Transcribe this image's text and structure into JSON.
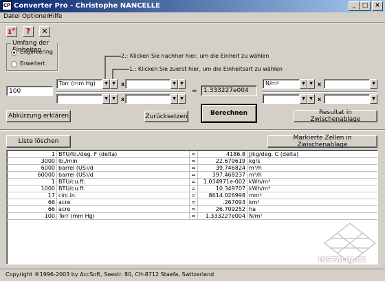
{
  "window": {
    "title": "Converter Pro - Christophe NANCELLE",
    "app_icon": "CP"
  },
  "menu": [
    "Datei",
    "Optionen",
    "Hilfe"
  ],
  "toolbar_icons": [
    "thermometer-icon",
    "pin-icon",
    "close-x-icon"
  ],
  "units_group": {
    "title": "Umfang der Einheiten",
    "options": [
      "Engineering",
      "Erweitert"
    ],
    "selected": "Engineering"
  },
  "hints": {
    "step2": "2.: Klicken Sie nachher hier, um die Einheit zu wählen",
    "step1": "1.: Klicken Sie zuerst hier, um die Einheitsart zu wählen"
  },
  "input_value": "100",
  "left_unit": "Torr (mm Hg)",
  "result_value": "1.333227e004",
  "right_unit": "N/m²",
  "operators": {
    "mult": "x",
    "div": "/",
    "equals": "="
  },
  "buttons": {
    "abbrev": "Abkürzung erklären",
    "reset": "Zurücksetzen",
    "calculate": "Berechnen",
    "result_clip": "Resultat in Zwischenablage",
    "clear_list": "Liste löschen",
    "marked_clip": "Markierte Zellen in Zwischenablage"
  },
  "table": [
    {
      "qty": "1",
      "unit": "BTU/lb./deg. F (delta)",
      "eq": "=",
      "value": "4186.8",
      "result_unit": "J/kg/deg. C (delta)"
    },
    {
      "qty": "3000",
      "unit": "lb./min",
      "eq": "=",
      "value": "22.679619",
      "result_unit": "kg/s"
    },
    {
      "qty": "6000",
      "unit": "barrel (US)/d",
      "eq": "=",
      "value": "39.746824",
      "result_unit": "m³/h"
    },
    {
      "qty": "60000",
      "unit": "barrel (US)/d",
      "eq": "=",
      "value": "397.468237",
      "result_unit": "m³/h"
    },
    {
      "qty": "1",
      "unit": "BTU/cu.ft.",
      "eq": "=",
      "value": "1.034971e-002",
      "result_unit": "kWh/m³"
    },
    {
      "qty": "1000",
      "unit": "BTU/cu.ft.",
      "eq": "=",
      "value": "10.349707",
      "result_unit": "kWh/m³"
    },
    {
      "qty": "17",
      "unit": "circ.in.",
      "eq": "=",
      "value": "8614.026998",
      "result_unit": "mm²"
    },
    {
      "qty": "66",
      "unit": "acre",
      "eq": "=",
      "value": ".267093",
      "result_unit": "km²"
    },
    {
      "qty": "66",
      "unit": "acre",
      "eq": "=",
      "value": "26.709252",
      "result_unit": "ha"
    },
    {
      "qty": "100",
      "unit": "Torr (mm Hg)",
      "eq": "=",
      "value": "1.333227e004",
      "result_unit": "N/m²"
    }
  ],
  "status": "Copyright ®1996-2003 by AccSoft, Seestr. 80, CH-8712 Staefa, Switzerland",
  "watermark": "INSTALUJ.CZ"
}
